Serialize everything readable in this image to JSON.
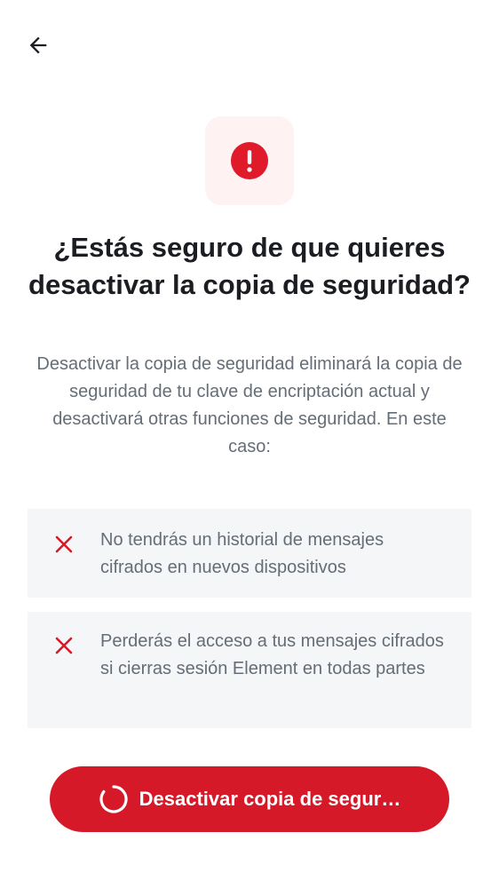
{
  "header": {
    "back_icon": "arrow-left-icon"
  },
  "alert": {
    "icon": "error-exclamation-icon",
    "color": "#e0192b",
    "tile_color": "#fff2f2"
  },
  "title": "¿Estás seguro de que quieres desactivar la copia de seguridad?",
  "description": "Desactivar la copia de seguridad eliminará la copia de seguridad de tu clave de encriptación actual y desactivará otras funciones de seguridad. En este caso:",
  "consequences": [
    {
      "icon": "close-x-icon",
      "text": "No tendrás un historial de mensajes cifrados en nuevos dispositivos"
    },
    {
      "icon": "close-x-icon",
      "text": "Perderás el acceso a tus mensajes cifrados si cierras sesión Element en todas partes"
    }
  ],
  "action": {
    "label": "Desactivar copia de segur…",
    "state_icon": "loading-spinner-icon",
    "color": "#d51928"
  }
}
